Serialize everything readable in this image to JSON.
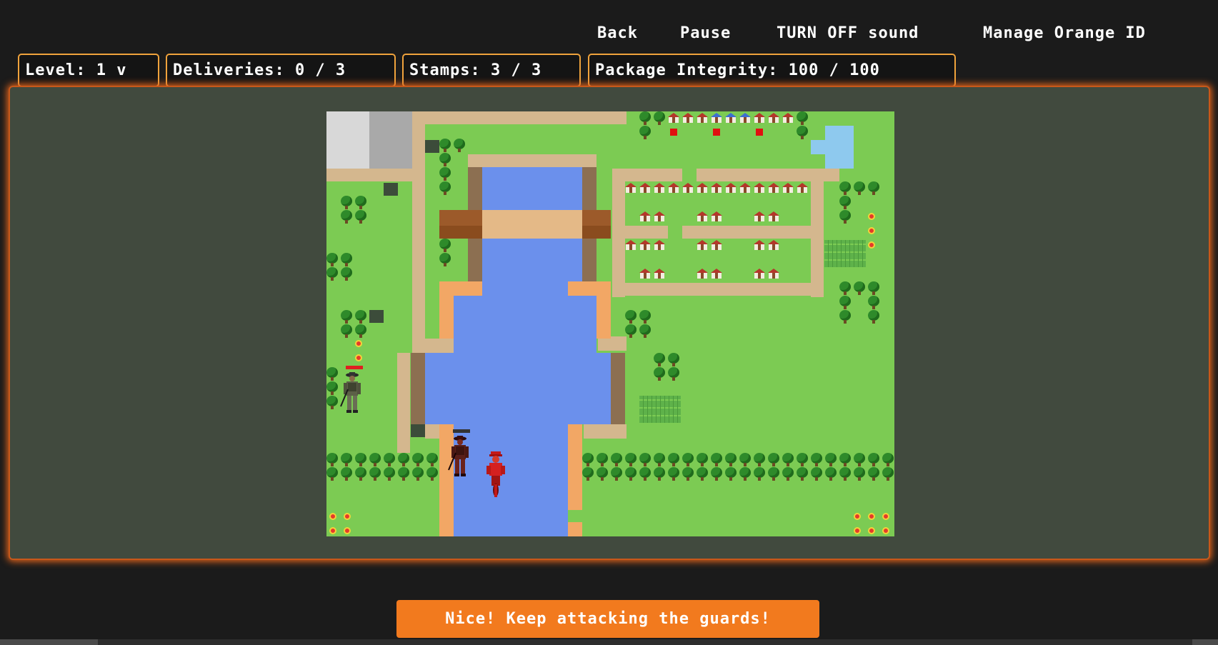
{
  "nav": {
    "back": "Back",
    "pause": "Pause",
    "sound": "TURN OFF sound",
    "manage": "Manage Orange ID"
  },
  "hud": {
    "level": "Level: 1 v",
    "deliveries": "Deliveries: 0 / 3",
    "stamps": "Stamps: 3 / 3",
    "integrity": "Package Integrity: 100 / 100"
  },
  "game": {
    "deliveries_done": 0,
    "deliveries_total": 3,
    "stamps": 3,
    "stamps_total": 3,
    "integrity": 100,
    "integrity_max": 100,
    "guards": [
      {
        "name": "guard-left",
        "health_fraction": 1.0,
        "bar_color": "#e02020"
      },
      {
        "name": "guard-river",
        "health_fraction": 0.0,
        "bar_color": "#e02020"
      }
    ]
  },
  "colors": {
    "accent": "#f27a1e",
    "hud_border": "#f0a33c",
    "grass": "#7ccb53",
    "water": "#6b90ec",
    "road": "#d4b78e"
  },
  "message": "Nice! Keep attacking the guards!"
}
